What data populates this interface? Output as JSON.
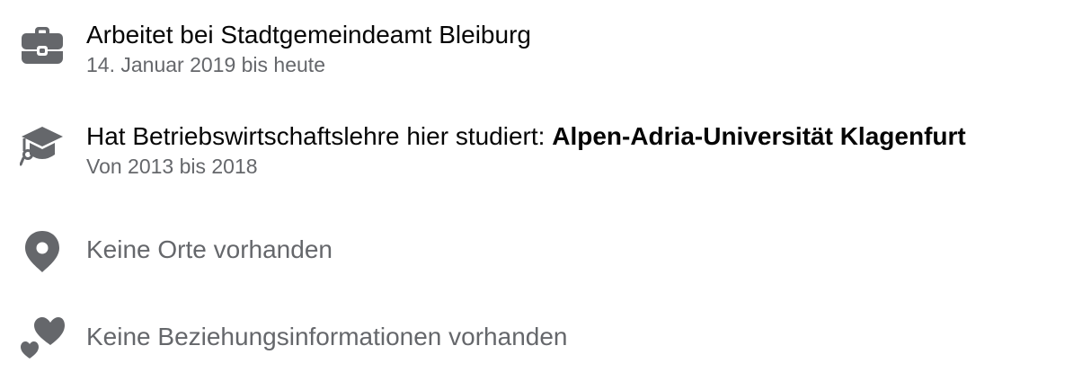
{
  "work": {
    "icon": "briefcase-icon",
    "title": "Arbeitet bei Stadtgemeindeamt Bleiburg",
    "subtitle": "14. Januar 2019 bis heute"
  },
  "education": {
    "icon": "graduation-cap-icon",
    "prefix": "Hat Betriebswirtschaftslehre hier studiert: ",
    "school": "Alpen-Adria-Universität Klagenfurt",
    "subtitle": "Von 2013 bis 2018"
  },
  "places": {
    "icon": "location-pin-icon",
    "text": "Keine Orte vorhanden"
  },
  "relationship": {
    "icon": "hearts-icon",
    "text": "Keine Beziehungsinformationen vorhanden"
  },
  "colors": {
    "icon": "#65676b",
    "primary_text": "#050505",
    "secondary_text": "#65676b"
  }
}
